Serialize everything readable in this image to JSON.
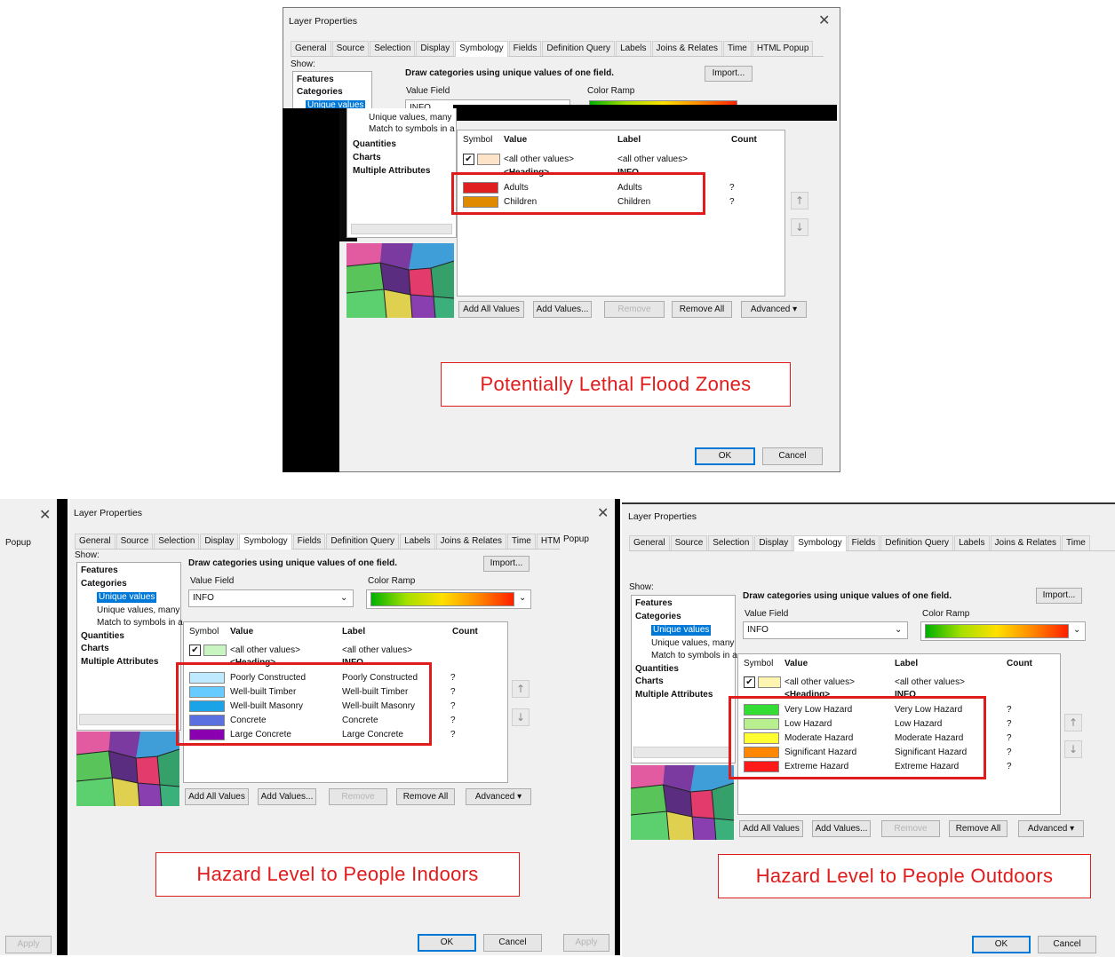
{
  "dialog": {
    "title": "Layer Properties",
    "tabs": [
      "General",
      "Source",
      "Selection",
      "Display",
      "Symbology",
      "Fields",
      "Definition Query",
      "Labels",
      "Joins & Relates",
      "Time",
      "HTML Popup"
    ],
    "show_label": "Show:",
    "tree": {
      "features": "Features",
      "categories": "Categories",
      "unique_values": "Unique values",
      "unique_values_many": "Unique values, many",
      "match_to_symbols": "Match to symbols in a",
      "quantities": "Quantities",
      "charts": "Charts",
      "multiple_attributes": "Multiple Attributes"
    },
    "heading": "Draw categories using unique values of one field.",
    "import_label": "Import...",
    "value_field_label": "Value Field",
    "value_field_value": "INFO",
    "color_ramp_label": "Color Ramp",
    "table_headers": {
      "symbol": "Symbol",
      "value": "Value",
      "label": "Label",
      "count": "Count"
    },
    "all_other_values": "<all other values>",
    "heading_row": "<Heading>",
    "heading_row_label": "INFO",
    "count_unknown": "?",
    "buttons": {
      "add_all": "Add All Values",
      "add_values": "Add Values...",
      "remove": "Remove",
      "remove_all": "Remove All",
      "advanced": "Advanced"
    },
    "ok": "OK",
    "cancel": "Cancel",
    "apply": "Apply",
    "popup": "Popup"
  },
  "panels": [
    {
      "caption": "Potentially Lethal Flood Zones",
      "rows": [
        {
          "value": "Adults",
          "label": "Adults",
          "color": "#e02020"
        },
        {
          "value": "Children",
          "label": "Children",
          "color": "#e08a00"
        }
      ]
    },
    {
      "caption": "Hazard Level to People Indoors",
      "rows": [
        {
          "value": "Poorly Constructed",
          "label": "Poorly Constructed",
          "color": "#bfe9ff"
        },
        {
          "value": "Well-built Timber",
          "label": "Well-built Timber",
          "color": "#66ccff"
        },
        {
          "value": "Well-built Masonry",
          "label": "Well-built Masonry",
          "color": "#1aa3e6"
        },
        {
          "value": "Concrete",
          "label": "Concrete",
          "color": "#5a6fe0"
        },
        {
          "value": "Large Concrete",
          "label": "Large Concrete",
          "color": "#8a00b0"
        }
      ]
    },
    {
      "caption": "Hazard Level to People Outdoors",
      "rows": [
        {
          "value": "Very Low Hazard",
          "label": "Very Low Hazard",
          "color": "#33dd33"
        },
        {
          "value": "Low Hazard",
          "label": "Low Hazard",
          "color": "#b8f090"
        },
        {
          "value": "Moderate Hazard",
          "label": "Moderate Hazard",
          "color": "#ffff33"
        },
        {
          "value": "Significant Hazard",
          "label": "Significant Hazard",
          "color": "#ff8800"
        },
        {
          "value": "Extreme Hazard",
          "label": "Extreme Hazard",
          "color": "#ff1a1a"
        }
      ]
    }
  ]
}
